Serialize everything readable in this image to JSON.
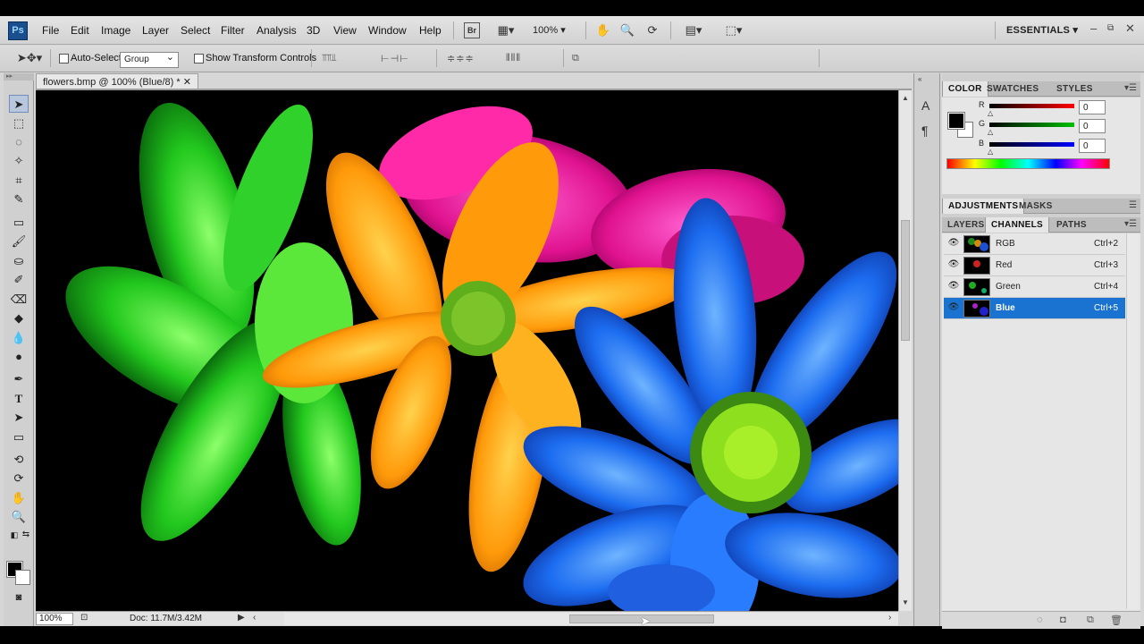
{
  "app": {
    "logo_text": "Ps",
    "menu": [
      "File",
      "Edit",
      "Image",
      "Layer",
      "Select",
      "Filter",
      "Analysis",
      "3D",
      "View",
      "Window",
      "Help"
    ],
    "bridge_label": "Br",
    "zoom_dropdown": "100%",
    "workspace": "ESSENTIALS",
    "window_controls": [
      "–",
      "⧉",
      "✕"
    ]
  },
  "options_bar": {
    "auto_select_label": "Auto-Select:",
    "auto_select_checked": false,
    "auto_select_value": "Group",
    "transform_label": "Show Transform Controls",
    "transform_checked": false
  },
  "document": {
    "tab_title": "flowers.bmp @ 100% (Blue/8) *",
    "tab_close": "✕",
    "zoom": "100%",
    "doc_info": "Doc: 11.7M/3.42M"
  },
  "color_panel": {
    "tabs": [
      "COLOR",
      "SWATCHES",
      "STYLES"
    ],
    "active_tab": "COLOR",
    "sliders": [
      {
        "label": "R",
        "value": "0",
        "color": "#ff0000"
      },
      {
        "label": "G",
        "value": "0",
        "color": "#00b000"
      },
      {
        "label": "B",
        "value": "0",
        "color": "#0000ff"
      }
    ],
    "foreground": "#000000",
    "background": "#ffffff"
  },
  "adjustments_panel": {
    "tabs": [
      "ADJUSTMENTS",
      "MASKS"
    ],
    "active_tab": "ADJUSTMENTS"
  },
  "channels_panel": {
    "tabs": [
      "LAYERS",
      "CHANNELS",
      "PATHS"
    ],
    "active_tab": "CHANNELS",
    "channels": [
      {
        "name": "RGB",
        "shortcut": "Ctrl+2",
        "selected": false
      },
      {
        "name": "Red",
        "shortcut": "Ctrl+3",
        "selected": false
      },
      {
        "name": "Green",
        "shortcut": "Ctrl+4",
        "selected": false
      },
      {
        "name": "Blue",
        "shortcut": "Ctrl+5",
        "selected": true
      }
    ]
  },
  "colors": {
    "selection": "#1a73d0",
    "canvas": "#000000"
  }
}
